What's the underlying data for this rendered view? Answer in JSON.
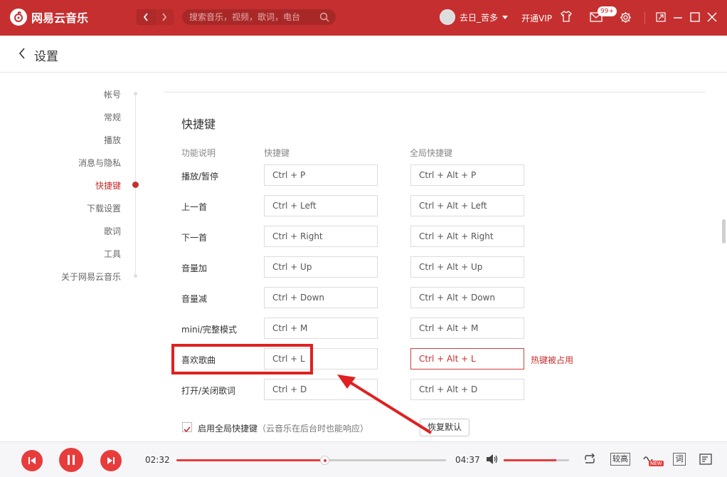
{
  "app": {
    "title": "网易云音乐"
  },
  "search": {
    "placeholder": "搜索音乐，视频，歌词，电台"
  },
  "user": {
    "name": "去日_苦多",
    "vip_label": "开通VIP",
    "message_badge": "99+"
  },
  "page": {
    "title": "设置"
  },
  "sidebar": {
    "items": [
      {
        "label": "帐号"
      },
      {
        "label": "常规"
      },
      {
        "label": "播放"
      },
      {
        "label": "消息与隐私"
      },
      {
        "label": "快捷键"
      },
      {
        "label": "下载设置"
      },
      {
        "label": "歌词"
      },
      {
        "label": "工具"
      },
      {
        "label": "关于网易云音乐"
      }
    ],
    "active_item": "快捷键"
  },
  "shortcuts": {
    "section_title": "快捷键",
    "headers": {
      "function": "功能说明",
      "shortcut": "快捷键",
      "global": "全局快捷键"
    },
    "rows": [
      {
        "label": "播放/暂停",
        "key": "Ctrl + P",
        "global": "Ctrl + Alt + P"
      },
      {
        "label": "上一首",
        "key": "Ctrl + Left",
        "global": "Ctrl + Alt + Left"
      },
      {
        "label": "下一首",
        "key": "Ctrl + Right",
        "global": "Ctrl + Alt + Right"
      },
      {
        "label": "音量加",
        "key": "Ctrl + Up",
        "global": "Ctrl + Alt + Up"
      },
      {
        "label": "音量减",
        "key": "Ctrl + Down",
        "global": "Ctrl + Alt + Down"
      },
      {
        "label": "mini/完整模式",
        "key": "Ctrl + M",
        "global": "Ctrl + Alt + M"
      },
      {
        "label": "喜欢歌曲",
        "key": "Ctrl + L",
        "global": "Ctrl + Alt + L",
        "conflict": "热键被占用"
      },
      {
        "label": "打开/关闭歌词",
        "key": "Ctrl + D",
        "global": "Ctrl + Alt + D"
      }
    ],
    "enable_global": {
      "label": "启用全局快捷键",
      "note": "（云音乐在后台时也能响应）",
      "checked": true
    },
    "restore_label": "恢复默认"
  },
  "player": {
    "current_time": "02:32",
    "total_time": "04:37",
    "progress_fraction": 0.55,
    "volume_fraction": 0.8,
    "quality_label": "较高",
    "lyric_label": "词",
    "new_tag": "NEW"
  },
  "colors": {
    "brand": "#c62f2f",
    "player_accent": "#e83c3c",
    "annotation": "#e02020"
  }
}
